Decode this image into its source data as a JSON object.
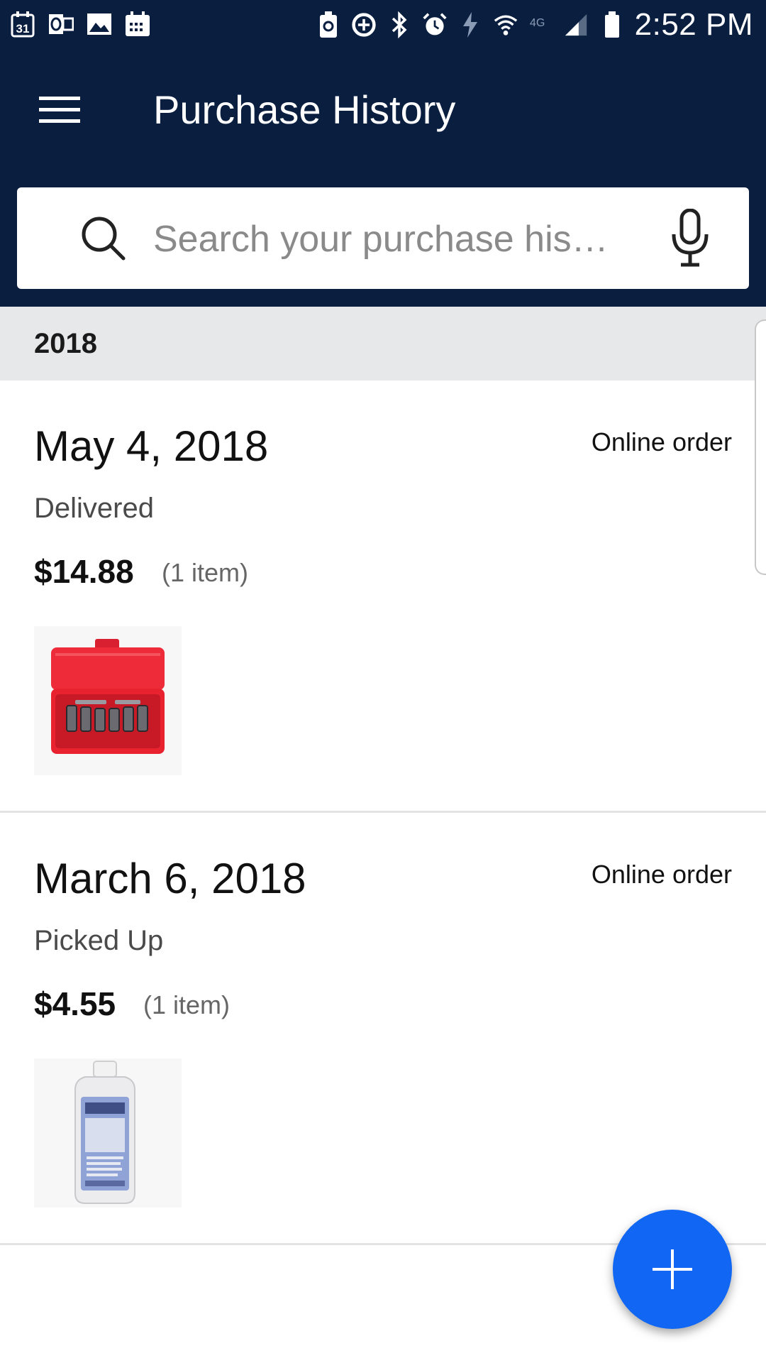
{
  "status_bar": {
    "left_icons": [
      "calendar-31-icon",
      "outlook-icon",
      "gallery-icon",
      "calendar-grid-icon"
    ],
    "calendar_day": "31",
    "right_icons": [
      "battery-saver-icon",
      "data-saver-icon",
      "bluetooth-icon",
      "alarm-icon",
      "charging-icon",
      "wifi-icon",
      "lte-icon",
      "signal-icon",
      "battery-icon"
    ],
    "network": "4G",
    "time": "2:52 PM"
  },
  "header": {
    "title": "Purchase History",
    "menu_icon": "hamburger-menu-icon"
  },
  "search": {
    "placeholder": "Search your purchase his…",
    "value": "",
    "search_icon": "search-icon",
    "mic_icon": "microphone-icon"
  },
  "year_header": "2018",
  "orders": [
    {
      "date": "May 4, 2018",
      "type": "Online order",
      "status": "Delivered",
      "price": "$14.88",
      "item_count": "(1 item)",
      "image": "red-socket-set-case"
    },
    {
      "date": "March 6, 2018",
      "type": "Online order",
      "status": "Picked Up",
      "price": "$4.55",
      "item_count": "(1 item)",
      "image": "humidifier-water-treatment-bottle"
    }
  ],
  "fab": {
    "icon": "plus-icon"
  },
  "colors": {
    "app_bar": "#0a1e40",
    "year_header_bg": "#e7e8ea",
    "fab": "#1166f4",
    "divider": "#e3e3e3"
  }
}
